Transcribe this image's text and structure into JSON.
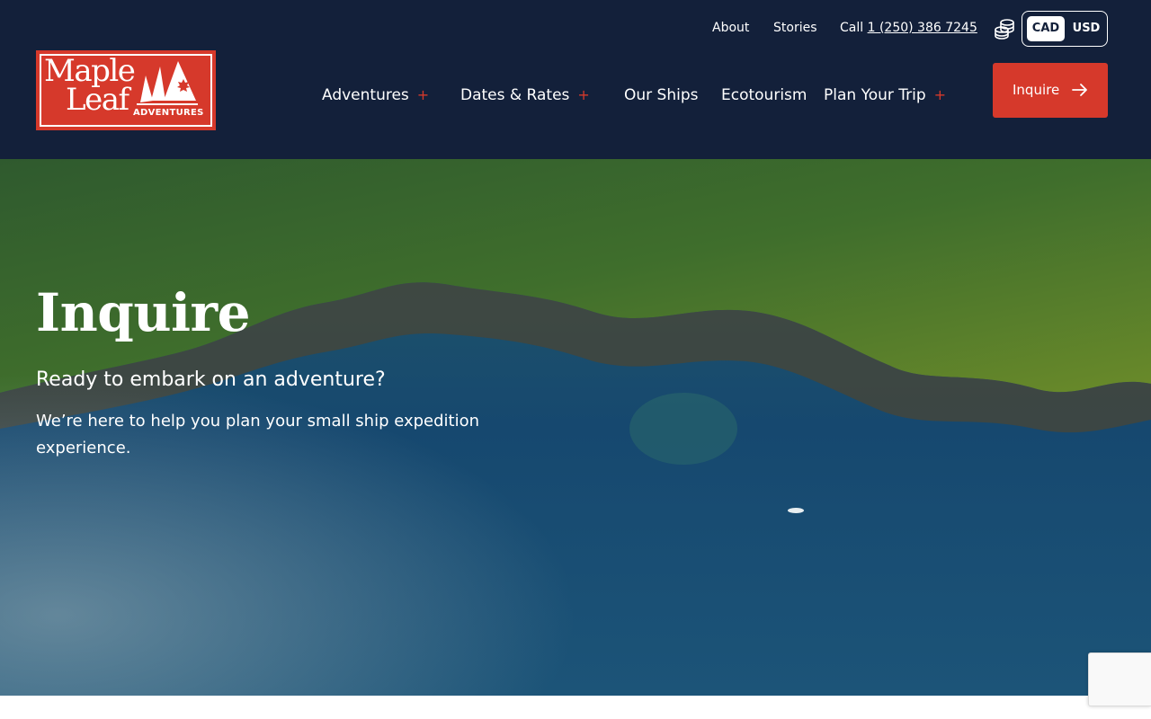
{
  "header": {
    "logo": {
      "line1": "Maple",
      "line2": "Leaf",
      "tagline": "ADVENTURES"
    },
    "utility_links": {
      "about": "About",
      "stories": "Stories",
      "call_prefix": "Call",
      "phone": "1 (250) 386 7245"
    },
    "currency": {
      "options": [
        "CAD",
        "USD"
      ],
      "selected": "CAD"
    },
    "nav": [
      {
        "label": "Adventures",
        "expand": "+"
      },
      {
        "label": "Dates & Rates",
        "expand": "+"
      },
      {
        "label": "Our Ships"
      },
      {
        "label": "Ecotourism"
      },
      {
        "label": "Plan Your Trip",
        "expand": "+"
      }
    ],
    "cta": {
      "label": "Inquire",
      "icon": "arrow-right-icon"
    }
  },
  "hero": {
    "title": "Inquire",
    "subtitle": "Ready to embark on an adventure?",
    "body": "We’re here to help you plan your small ship expedition experience."
  },
  "colors": {
    "header_bg": "#13203a",
    "accent": "#d6392b",
    "text": "#ffffff"
  },
  "icons": {
    "currency": "coins-icon",
    "cta": "arrow-right-icon"
  }
}
